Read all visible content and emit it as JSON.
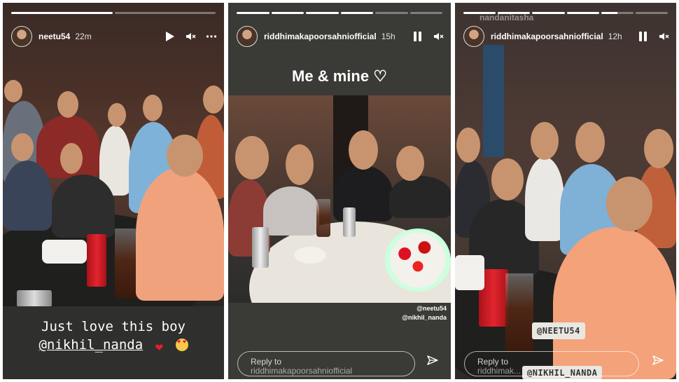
{
  "panels": [
    {
      "username": "neetu54",
      "time": "22m",
      "progress": [
        1,
        0
      ],
      "controls": [
        "play-icon",
        "mute-icon",
        "more-icon"
      ],
      "caption_line1": "Just love this boy",
      "caption_mention": "@nikhil_nanda",
      "caption_emojis": [
        "red-heart-emoji",
        "heart-eyes-emoji"
      ]
    },
    {
      "username": "riddhimakapoorsahniofficial",
      "time": "15h",
      "progress": [
        1,
        1,
        1,
        1,
        0,
        0
      ],
      "controls": [
        "pause-icon",
        "mute-icon"
      ],
      "title_text": "Me & mine",
      "title_emoji": "♡",
      "tag1": "@neetu54",
      "tag2": "@nikhil_nanda",
      "reply_placeholder": "Reply to",
      "reply_placeholder_2": "riddhimakapoorsahniofficial"
    },
    {
      "username": "riddhimakapoorsahniofficial",
      "time": "12h",
      "faded_name": "nandanitasha",
      "progress": [
        1,
        1,
        1,
        1,
        0.5,
        0
      ],
      "controls": [
        "pause-icon",
        "mute-icon"
      ],
      "sticker1": "@NEETU54",
      "sticker2": "@NIKHIL_NANDA",
      "reply_placeholder": "Reply to",
      "reply_placeholder_2": "riddhimak..."
    }
  ]
}
